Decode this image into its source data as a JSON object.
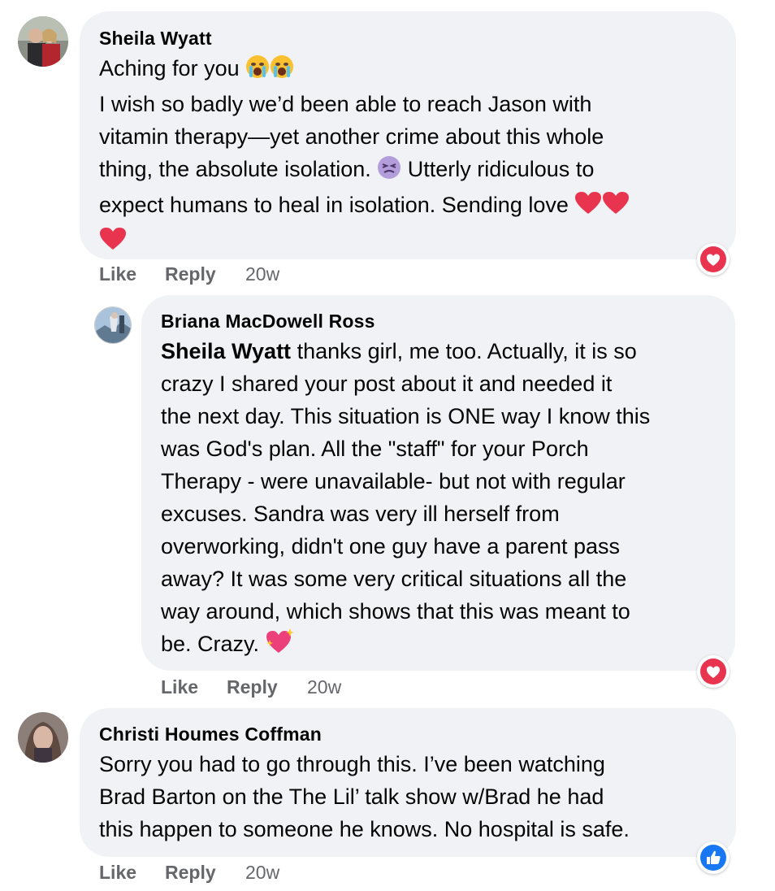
{
  "comments": [
    {
      "author": "Sheila Wyatt",
      "line1": "Aching for you",
      "body": "I wish so badly we’d been able to reach Jason with\nvitamin therapy—yet another crime about this whole\nthing, the absolute isolation.",
      "body2": " Utterly ridiculous to\nexpect humans to heal in isolation. Sending love ",
      "like": "Like",
      "reply": "Reply",
      "time": "20w",
      "reaction": "love"
    },
    {
      "author": "Briana MacDowell Ross",
      "mention": "Sheila Wyatt",
      "body": " thanks girl, me too. Actually, it is so\ncrazy I shared your post about it and needed it\nthe next day. This situation is ONE way I know this\nwas God's plan. All the \"staff\" for your Porch\nTherapy - were unavailable- but not with regular\nexcuses. Sandra was very ill herself from\noverworking, didn't one guy have a parent pass\naway? It was some very critical situations all the\nway around, which shows that this was meant to\nbe. Crazy. ",
      "like": "Like",
      "reply": "Reply",
      "time": "20w",
      "reaction": "love"
    },
    {
      "author": "Christi Houmes Coffman",
      "body": "Sorry you had to go through this. I’ve been watching\nBrad Barton on the The Lil’ talk show w/Brad he had\nthis happen to someone he knows. No hospital is safe.",
      "like": "Like",
      "reply": "Reply",
      "time": "20w",
      "reaction": "like"
    }
  ],
  "colors": {
    "bubble": "#f0f2f5",
    "meta": "#65676b",
    "love": "#e8344e",
    "like": "#1877f2"
  }
}
